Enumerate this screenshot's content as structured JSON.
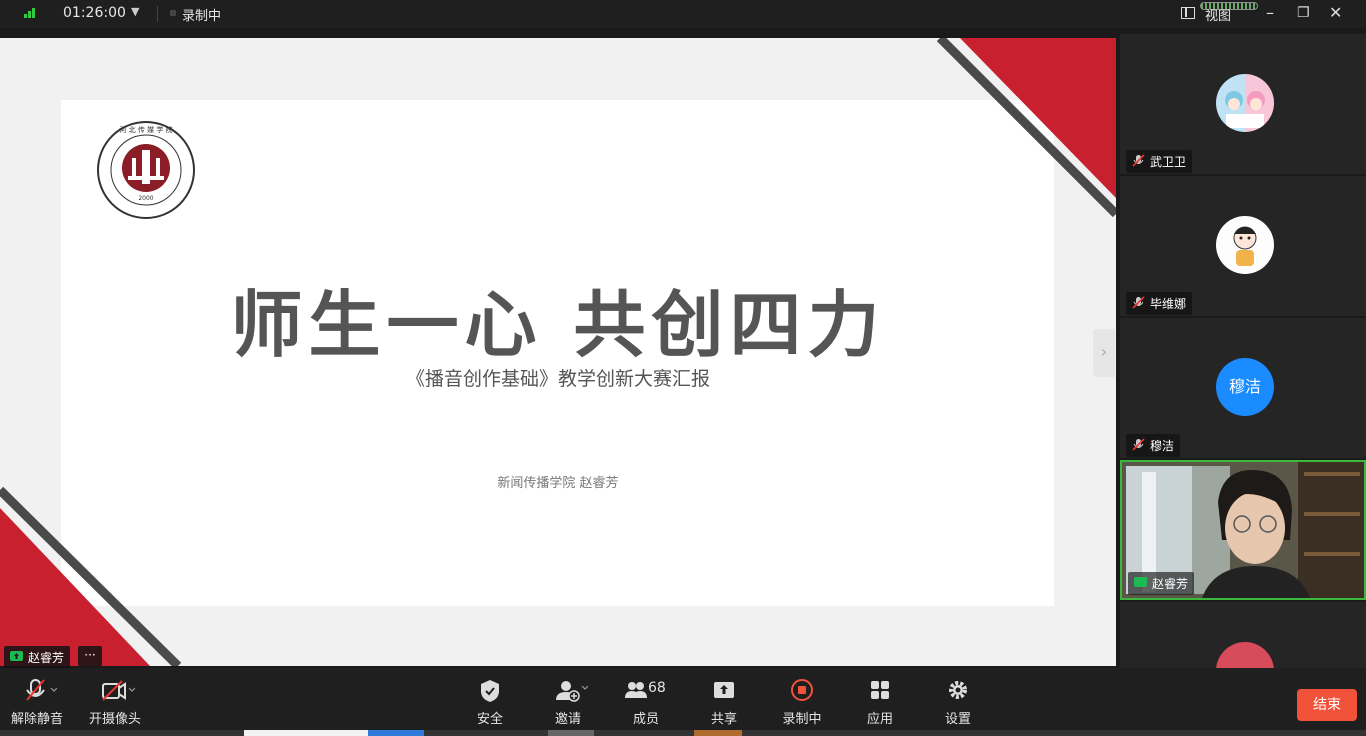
{
  "topbar": {
    "elapsed": "01:26:00",
    "recording_status": "录制中",
    "view_label": "视图",
    "icons": [
      "signal-icon",
      "dropdown-icon",
      "view-layout-icon",
      "minimize-icon",
      "maximize-icon",
      "close-icon"
    ]
  },
  "slide": {
    "title": "师生一心 共创四力",
    "subtitle": "《播音创作基础》教学创新大赛汇报",
    "author": "新闻传播学院 赵睿芳",
    "logo_ring_text": "河北传媒学院 Hebei Institute of Communications",
    "logo_year": "2000",
    "accent_color": "#c8202f",
    "stripe_color": "#4a4a4a",
    "presenter_tag": "赵睿芳",
    "more_label": "···",
    "expand_icon": "chevron-right-icon"
  },
  "participants": [
    {
      "name": "武卫卫",
      "avatar": "anime-girl-avatar",
      "muted": true
    },
    {
      "name": "毕维娜",
      "avatar": "cartoon-avatar",
      "muted": true
    },
    {
      "name": "穆洁",
      "avatar_text": "穆洁",
      "avatar_color": "#1a8cff",
      "muted": true
    },
    {
      "name": "赵睿芳",
      "avatar": "live-video",
      "muted": false,
      "active_speaker": true
    }
  ],
  "toolbar": {
    "unmute": "解除静音",
    "camera": "开摄像头",
    "security": "安全",
    "invite": "邀请",
    "members": "成员",
    "member_count": "68",
    "share": "共享",
    "recording": "录制中",
    "apps": "应用",
    "settings": "设置",
    "end": "结束"
  }
}
